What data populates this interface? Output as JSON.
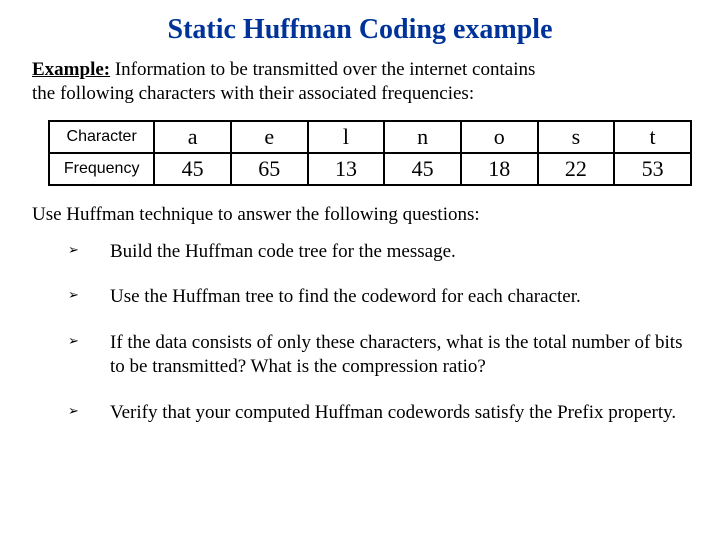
{
  "title": "Static Huffman Coding example",
  "example": {
    "label": "Example:",
    "text_l1": " Information to be transmitted over the internet contains",
    "text_l2": " the following characters with their associated frequencies:"
  },
  "table": {
    "row_labels": {
      "char": "Character",
      "freq": "Frequency"
    },
    "cols": [
      {
        "char": "a",
        "freq": "45"
      },
      {
        "char": "e",
        "freq": "65"
      },
      {
        "char": "l",
        "freq": "13"
      },
      {
        "char": "n",
        "freq": "45"
      },
      {
        "char": "o",
        "freq": "18"
      },
      {
        "char": "s",
        "freq": "22"
      },
      {
        "char": "t",
        "freq": "53"
      }
    ]
  },
  "instruction": "Use Huffman technique to answer the following questions:",
  "bullets": [
    "Build the Huffman code tree for the message.",
    "Use the Huffman tree to find the codeword for each character.",
    "If the data consists of only these characters, what is the total number of  bits to be transmitted? What is the compression ratio?",
    "Verify that your computed Huffman codewords satisfy the Prefix property."
  ]
}
